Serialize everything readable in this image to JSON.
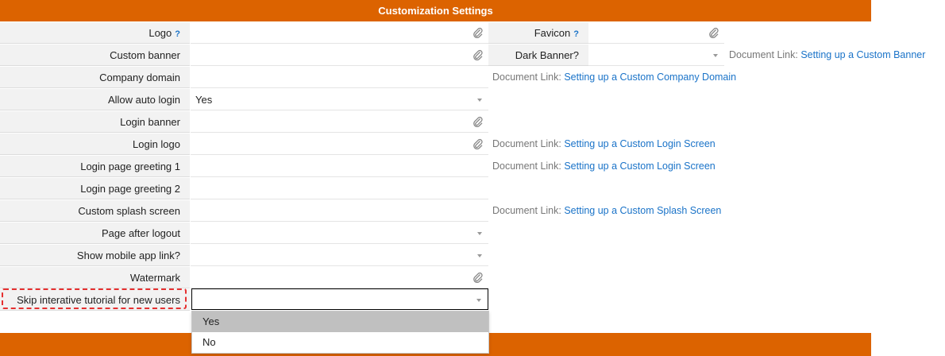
{
  "header": {
    "title": "Customization Settings"
  },
  "rows": [
    {
      "label": "Logo",
      "help": "?",
      "value": "",
      "control": "file"
    },
    {
      "label": "Custom banner",
      "value": "",
      "control": "file"
    },
    {
      "label": "Company domain",
      "value": "",
      "control": "text"
    },
    {
      "label": "Allow auto login",
      "value": "Yes",
      "control": "select"
    },
    {
      "label": "Login banner",
      "value": "",
      "control": "file"
    },
    {
      "label": "Login logo",
      "value": "",
      "control": "file"
    },
    {
      "label": "Login page greeting 1",
      "value": "",
      "control": "text"
    },
    {
      "label": "Login page greeting 2",
      "value": "",
      "control": "text"
    },
    {
      "label": "Custom splash screen",
      "value": "",
      "control": "text"
    },
    {
      "label": "Page after logout",
      "value": "",
      "control": "select"
    },
    {
      "label": "Show mobile app link?",
      "value": "",
      "control": "select"
    },
    {
      "label": "Watermark",
      "value": "",
      "control": "file"
    },
    {
      "label": "Skip interative tutorial for new users",
      "value": "",
      "control": "select"
    }
  ],
  "side_fields": [
    {
      "label": "Favicon",
      "help": "?",
      "control": "file"
    },
    {
      "label": "Dark Banner?",
      "control": "select"
    }
  ],
  "doc_links": {
    "prefix": "Document Link:",
    "custom_banner": "Setting up a Custom Banner",
    "company_domain": "Setting up a Custom Company Domain",
    "login_logo": "Setting up a Custom Login Screen",
    "login_greeting": "Setting up a Custom Login Screen",
    "splash": "Setting up a Custom Splash Screen"
  },
  "dropdown": {
    "options": [
      "Yes",
      "No"
    ],
    "highlighted": "Yes"
  },
  "colors": {
    "brand": "#dc6300",
    "link": "#1a73c8",
    "highlight_box": "#e53030"
  }
}
